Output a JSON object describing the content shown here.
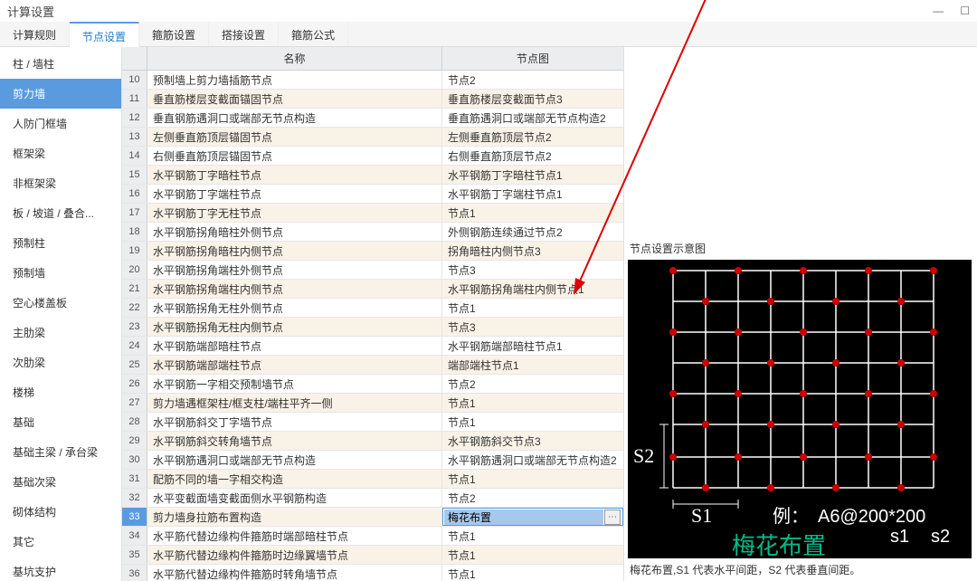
{
  "window": {
    "title": "计算设置"
  },
  "tabs": [
    "计算规则",
    "节点设置",
    "箍筋设置",
    "搭接设置",
    "箍筋公式"
  ],
  "active_tab": 1,
  "sidebar": {
    "items": [
      "柱 / 墙柱",
      "剪力墙",
      "人防门框墙",
      "框架梁",
      "非框架梁",
      "板 / 坡道 / 叠合...",
      "预制柱",
      "预制墙",
      "空心楼盖板",
      "主肋梁",
      "次肋梁",
      "楼梯",
      "基础",
      "基础主梁 / 承台梁",
      "基础次梁",
      "砌体结构",
      "其它",
      "基坑支护"
    ],
    "active": 1
  },
  "table": {
    "head": {
      "name": "名称",
      "node": "节点图"
    },
    "rows": [
      {
        "n": 10,
        "name": "预制墙上剪力墙插筋节点",
        "node": "节点2"
      },
      {
        "n": 11,
        "name": "垂直筋楼层变截面锚固节点",
        "node": "垂直筋楼层变截面节点3"
      },
      {
        "n": 12,
        "name": "垂直钢筋遇洞口或端部无节点构造",
        "node": "垂直筋遇洞口或端部无节点构造2"
      },
      {
        "n": 13,
        "name": "左侧垂直筋顶层锚固节点",
        "node": "左侧垂直筋顶层节点2"
      },
      {
        "n": 14,
        "name": "右侧垂直筋顶层锚固节点",
        "node": "右侧垂直筋顶层节点2"
      },
      {
        "n": 15,
        "name": "水平钢筋丁字暗柱节点",
        "node": "水平钢筋丁字暗柱节点1"
      },
      {
        "n": 16,
        "name": "水平钢筋丁字端柱节点",
        "node": "水平钢筋丁字端柱节点1"
      },
      {
        "n": 17,
        "name": "水平钢筋丁字无柱节点",
        "node": "节点1"
      },
      {
        "n": 18,
        "name": "水平钢筋拐角暗柱外侧节点",
        "node": "外侧钢筋连续通过节点2"
      },
      {
        "n": 19,
        "name": "水平钢筋拐角暗柱内侧节点",
        "node": "拐角暗柱内侧节点3"
      },
      {
        "n": 20,
        "name": "水平钢筋拐角端柱外侧节点",
        "node": "节点3"
      },
      {
        "n": 21,
        "name": "水平钢筋拐角端柱内侧节点",
        "node": "水平钢筋拐角端柱内侧节点1"
      },
      {
        "n": 22,
        "name": "水平钢筋拐角无柱外侧节点",
        "node": "节点1"
      },
      {
        "n": 23,
        "name": "水平钢筋拐角无柱内侧节点",
        "node": "节点3"
      },
      {
        "n": 24,
        "name": "水平钢筋端部暗柱节点",
        "node": "水平钢筋端部暗柱节点1"
      },
      {
        "n": 25,
        "name": "水平钢筋端部端柱节点",
        "node": "端部端柱节点1"
      },
      {
        "n": 26,
        "name": "水平钢筋一字相交预制墙节点",
        "node": "节点2"
      },
      {
        "n": 27,
        "name": "剪力墙遇框架柱/框支柱/端柱平齐一侧",
        "node": "节点1"
      },
      {
        "n": 28,
        "name": "水平钢筋斜交丁字墙节点",
        "node": "节点1"
      },
      {
        "n": 29,
        "name": "水平钢筋斜交转角墙节点",
        "node": "水平钢筋斜交节点3"
      },
      {
        "n": 30,
        "name": "水平钢筋遇洞口或端部无节点构造",
        "node": "水平钢筋遇洞口或端部无节点构造2"
      },
      {
        "n": 31,
        "name": "配筋不同的墙一字相交构造",
        "node": "节点1"
      },
      {
        "n": 32,
        "name": "水平变截面墙变截面侧水平钢筋构造",
        "node": "节点2"
      },
      {
        "n": 33,
        "name": "剪力墙身拉筋布置构造",
        "node": "梅花布置",
        "selected": true
      },
      {
        "n": 34,
        "name": "水平筋代替边缘构件箍筋时端部暗柱节点",
        "node": "节点1"
      },
      {
        "n": 35,
        "name": "水平筋代替边缘构件箍筋时边缘翼墙节点",
        "node": "节点1"
      },
      {
        "n": 36,
        "name": "水平筋代替边缘构件箍筋时转角墙节点",
        "node": "节点1"
      }
    ]
  },
  "right": {
    "title": "节点设置示意图",
    "s1": "S1",
    "s2": "S2",
    "example_label": "例：",
    "example_value": "A6@200*200",
    "sub_s1": "s1",
    "sub_s2": "s2",
    "big_label": "梅花布置",
    "caption": "梅花布置,S1 代表水平间距，S2 代表垂直间距。"
  }
}
